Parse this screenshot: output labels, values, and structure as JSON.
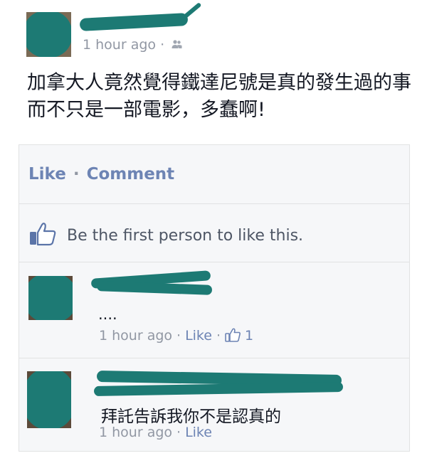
{
  "post": {
    "time": "1 hour ago",
    "meta_separator": "·",
    "audience_icon": "friends-icon",
    "text": "加拿大人竟然覺得鐵達尼號是真的發生過的事而不只是一部電影，多蠢啊!"
  },
  "actions": {
    "like_label": "Like",
    "separator": "·",
    "comment_label": "Comment"
  },
  "likes_summary": {
    "icon": "thumbs-up-icon",
    "text": "Be the first person to like this."
  },
  "comments": [
    {
      "text": "....",
      "time": "1 hour ago",
      "separator": "·",
      "like_label": "Like",
      "like_count": "1"
    },
    {
      "text": "拜託告訴我你不是認真的",
      "time": "1 hour ago",
      "separator": "·",
      "like_label": "Like"
    }
  ],
  "colors": {
    "link": "#6d84b4",
    "meta": "#9197a3",
    "redaction": "#1d7a74",
    "panel": "#f6f7f9"
  }
}
